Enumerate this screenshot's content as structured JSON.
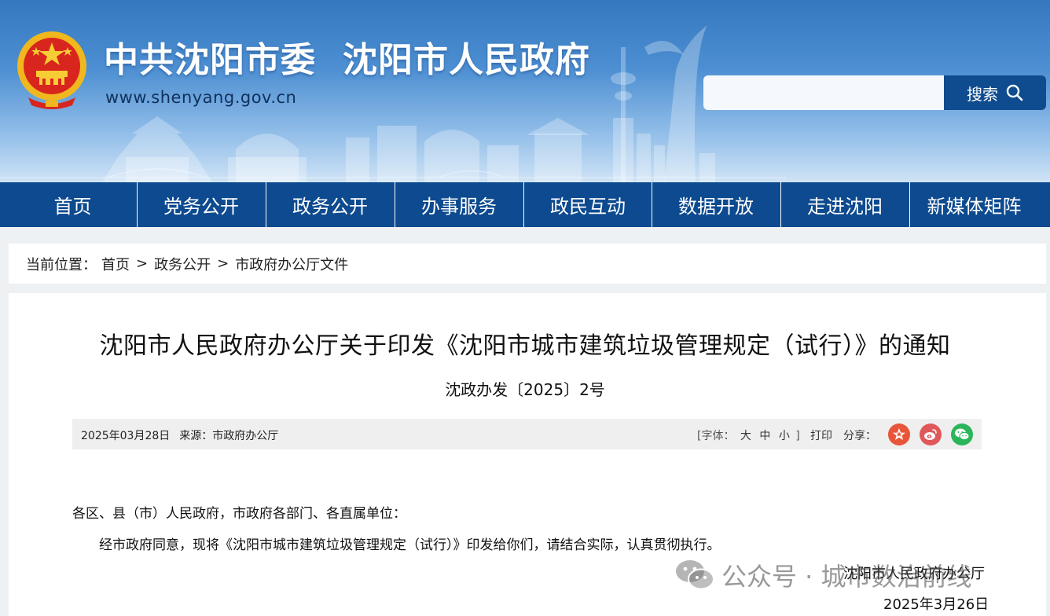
{
  "header": {
    "title_part1": "中共沈阳市委",
    "title_part2": "沈阳市人民政府",
    "url": "www.shenyang.gov.cn",
    "search_placeholder": "",
    "search_label": "搜索"
  },
  "nav": {
    "items": [
      "首页",
      "党务公开",
      "政务公开",
      "办事服务",
      "政民互动",
      "数据开放",
      "走进沈阳",
      "新媒体矩阵"
    ]
  },
  "breadcrumb": {
    "label": "当前位置：",
    "items": [
      "首页",
      "政务公开",
      "市政府办公厅文件"
    ],
    "separator": ">"
  },
  "article": {
    "title": "沈阳市人民政府办公厅关于印发《沈阳市城市建筑垃圾管理规定（试行）》的通知",
    "doc_number": "沈政办发〔2025〕2号",
    "date": "2025年03月28日",
    "source": "来源：市政府办公厅",
    "font_label_open": "[字体：",
    "font_sizes": [
      "大",
      "中",
      "小"
    ],
    "font_label_close": "]",
    "print_label": "打印",
    "share_label": "分享：",
    "share_icons": [
      "party-emblem-icon",
      "weibo-icon",
      "wechat-icon"
    ],
    "salutation": "各区、县（市）人民政府，市政府各部门、各直属单位：",
    "paragraph": "经市政府同意，现将《沈阳市城市建筑垃圾管理规定（试行）》印发给你们，请结合实际，认真贯彻执行。",
    "signature": "沈阳市人民政府办公厅",
    "sign_date": "2025年3月26日"
  },
  "watermark": {
    "text": "公众号 · 城市数治前线"
  },
  "colors": {
    "nav_bg": "#0d4a8f",
    "search_btn": "#0f4c8f",
    "share_red": "#e9553a",
    "share_weibo": "#e0595a",
    "share_wechat": "#2bb55b"
  }
}
